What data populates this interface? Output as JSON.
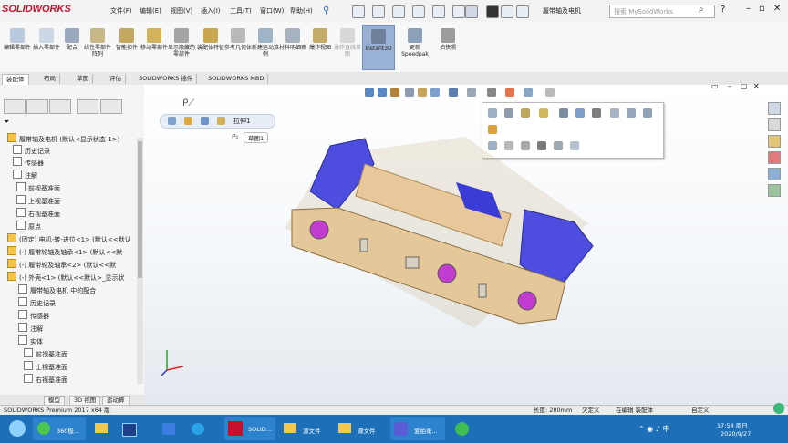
{
  "menubar": {
    "logo": "SOLIDWORKS",
    "items": [
      "文件(F)",
      "编辑(E)",
      "视图(V)",
      "插入(I)",
      "工具(T)",
      "窗口(W)",
      "帮助(H)"
    ],
    "doc_name": "履带轴及电机",
    "search_placeholder": "搜索 MySolidWorks",
    "help": "?"
  },
  "command_manager": {
    "buttons": [
      "编辑零部件",
      "插入零部件",
      "配合",
      "线性零部件阵列",
      "智能扣件",
      "移动零部件",
      "显示隐藏的零部件",
      "装配体特征",
      "参考几何体",
      "新建运动算例",
      "材料明细表",
      "爆炸视图",
      "爆炸直线草图",
      "Instant3D",
      "更新Speedpak",
      "拍快照"
    ],
    "active": "Instant3D"
  },
  "tabs": {
    "items": [
      "装配体",
      "布局",
      "草图",
      "评估",
      "SOLIDWORKS 插件",
      "SOLIDWORKS MBD"
    ],
    "selected": "装配体"
  },
  "feature_tree": {
    "root": "履带轴及电机 (默认<显示状态-1>)",
    "items": [
      "历史记录",
      "传感器",
      "注解",
      "前视基准面",
      "上视基准面",
      "右视基准面",
      "原点",
      "(固定) 电机-转-进位<1> (默认<<默认",
      "(-) 履带轮轴及轴承<1> (默认<<默",
      "(-) 履带轮及轴承<2> (默认<<默",
      "(-) 外壳<1> (默认<<默认>_显示状",
      "履带轴及电机 中的配合",
      "历史记录",
      "传感器",
      "注解",
      "实体",
      "前视基准面",
      "上视基准面",
      "右视基准面"
    ]
  },
  "bottom_tabs": [
    "模型",
    "3D 视图",
    "运动算"
  ],
  "canvas": {
    "breadcrumb_label": "拉伸1",
    "tm_label": "草图1"
  },
  "status": {
    "app": "SOLIDWORKS Premium 2017 x64 版",
    "length": "长度: 280mm",
    "state": "欠定义",
    "editing": "在编辑 装配体",
    "custom": "自定义"
  },
  "taskbar": {
    "apps": [
      "360极...",
      "SOLID...",
      "源文件",
      "源文件",
      "爱拍录...",
      ""
    ],
    "time": "17:58 周日",
    "date": "2020/9/27"
  },
  "colors": {
    "brand_red": "#c8102e",
    "active_button": "#9ab1d6",
    "taskbar": "#1d6fb8",
    "track_blue": "#4d4de0",
    "chassis_tan": "#e8c89a"
  }
}
